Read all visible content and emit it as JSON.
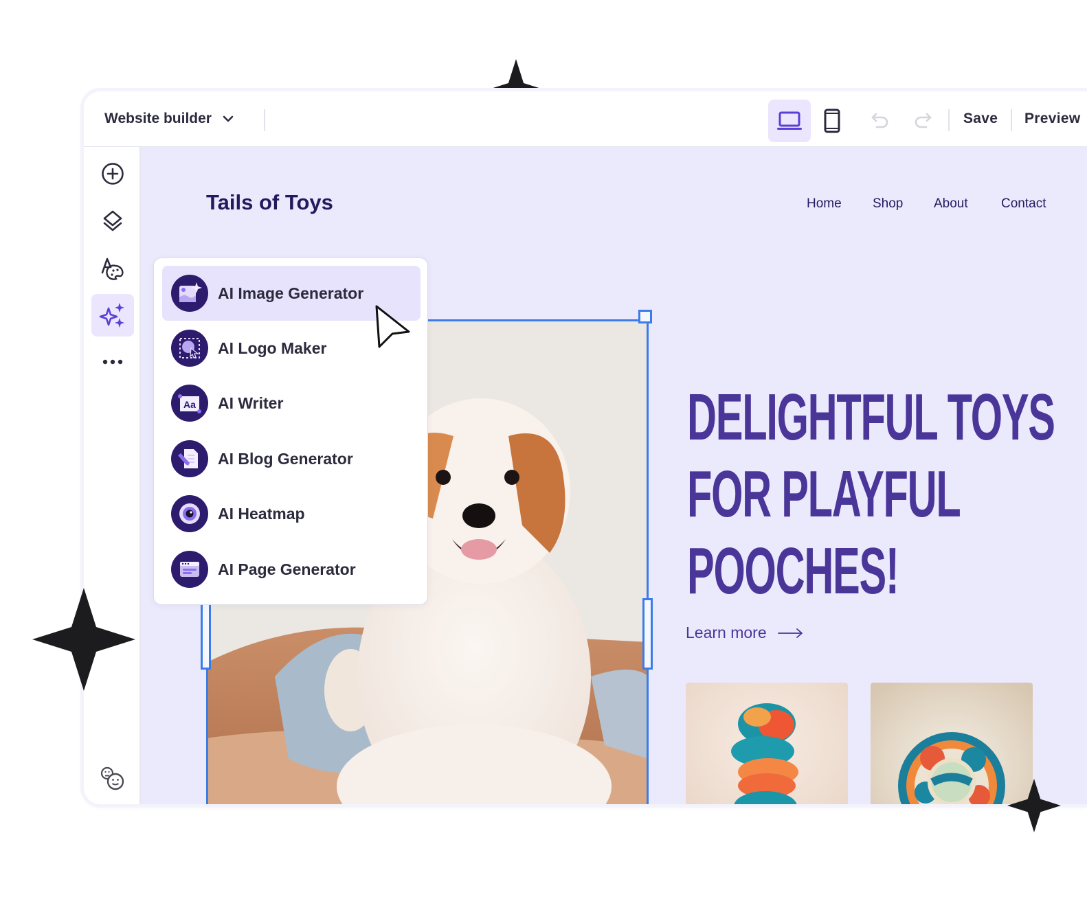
{
  "topbar": {
    "title": "Website builder",
    "title_icon": "chevron-down-icon",
    "devices": [
      {
        "name": "desktop",
        "icon": "laptop-icon",
        "active": true
      },
      {
        "name": "mobile",
        "icon": "phone-icon",
        "active": false
      }
    ],
    "undo_icon": "undo-icon",
    "redo_icon": "redo-icon",
    "save_label": "Save",
    "preview_label": "Preview"
  },
  "sidebar": {
    "items": [
      {
        "name": "add",
        "icon": "plus-circle-icon",
        "active": false
      },
      {
        "name": "layers",
        "icon": "layers-icon",
        "active": false
      },
      {
        "name": "theme",
        "icon": "font-palette-icon",
        "active": false
      },
      {
        "name": "ai",
        "icon": "sparkles-icon",
        "active": true
      },
      {
        "name": "more",
        "icon": "more-horizontal-icon",
        "active": false
      }
    ],
    "bottom_icon": "feedback-faces-icon"
  },
  "site": {
    "logo": "Tails of Toys",
    "nav": [
      "Home",
      "Shop",
      "About",
      "Contact"
    ],
    "headline": [
      "DELIGHTFUL TOYS",
      "FOR PLAYFUL",
      "POOCHES!"
    ],
    "cta": "Learn more",
    "cta_icon": "arrow-right-icon",
    "hero_image": "puppy-photo",
    "products": [
      "twisted-rope-toy-photo",
      "knotted-ball-toy-photo"
    ]
  },
  "ai_menu": {
    "items": [
      {
        "label": "AI Image Generator",
        "icon": "ai-image-icon",
        "active": true
      },
      {
        "label": "AI Logo Maker",
        "icon": "ai-logo-icon",
        "active": false
      },
      {
        "label": "AI Writer",
        "icon": "ai-writer-icon",
        "active": false
      },
      {
        "label": "AI Blog Generator",
        "icon": "ai-blog-icon",
        "active": false
      },
      {
        "label": "AI Heatmap",
        "icon": "ai-heatmap-icon",
        "active": false
      },
      {
        "label": "AI Page Generator",
        "icon": "ai-page-icon",
        "active": false
      }
    ]
  },
  "colors": {
    "accent": "#5b3fd6",
    "active_bg": "#ebe6fd",
    "canvas_bg": "#ebe9fc",
    "headline": "#4a3599",
    "selection": "#3b7cea",
    "icon_circle": "#2d1b6e"
  }
}
